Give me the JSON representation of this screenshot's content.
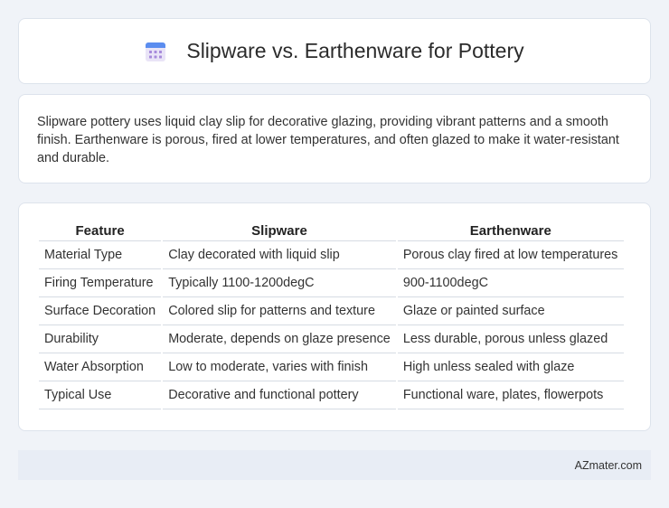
{
  "header": {
    "title": "Slipware vs. Earthenware for Pottery",
    "icon": "calendar-icon",
    "icon_colors": {
      "top": "#5b8def",
      "grid": "#a78bdb",
      "bg": "#e9e4f7"
    }
  },
  "description": {
    "text": "Slipware pottery uses liquid clay slip for decorative glazing, providing vibrant patterns and a smooth finish. Earthenware is porous, fired at lower temperatures, and often glazed to make it water-resistant and durable."
  },
  "table": {
    "headers": [
      "Feature",
      "Slipware",
      "Earthenware"
    ],
    "rows": [
      [
        "Material Type",
        "Clay decorated with liquid slip",
        "Porous clay fired at low temperatures"
      ],
      [
        "Firing Temperature",
        "Typically 1100-1200degC",
        "900-1100degC"
      ],
      [
        "Surface Decoration",
        "Colored slip for patterns and texture",
        "Glaze or painted surface"
      ],
      [
        "Durability",
        "Moderate, depends on glaze presence",
        "Less durable, porous unless glazed"
      ],
      [
        "Water Absorption",
        "Low to moderate, varies with finish",
        "High unless sealed with glaze"
      ],
      [
        "Typical Use",
        "Decorative and functional pottery",
        "Functional ware, plates, flowerpots"
      ]
    ]
  },
  "footer": {
    "site": "AZmater.com"
  }
}
